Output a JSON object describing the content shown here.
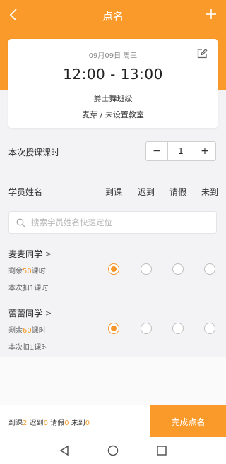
{
  "header": {
    "title": "点名",
    "back_icon": "chevron-left-icon",
    "add_icon": "plus-icon",
    "bg_color": "#f99a2a"
  },
  "card": {
    "date": "09月09日 周三",
    "time": "12:00 - 13:00",
    "class_name": "爵士舞班级",
    "room": "麦芽 / 未设置教室",
    "edit_icon": "edit-icon"
  },
  "lesson_hours": {
    "label": "本次授课课时",
    "minus": "−",
    "value": "1",
    "plus": "+"
  },
  "columns": {
    "student_name": "学员姓名",
    "present": "到课",
    "late": "迟到",
    "leave": "请假",
    "absent": "未到"
  },
  "search": {
    "placeholder": "搜索学员姓名快速定位",
    "icon": "search-icon"
  },
  "students": [
    {
      "name": "麦麦同学",
      "remain_prefix": "剩余",
      "remain_num": "50",
      "remain_suffix": "课时",
      "deduct": "本次扣1课时",
      "status": "present"
    },
    {
      "name": "蕾蕾同学",
      "remain_prefix": "剩余",
      "remain_num": "60",
      "remain_suffix": "课时",
      "deduct": "本次扣1课时",
      "status": "present"
    }
  ],
  "summary": {
    "present_label": "到课",
    "present_count": "2",
    "late_label": "迟到",
    "late_count": "0",
    "leave_label": "请假",
    "leave_count": "0",
    "absent_label": "未到",
    "absent_count": "0"
  },
  "complete_button": "完成点名",
  "navbar": {
    "back_icon": "nav-back-triangle-icon",
    "home_icon": "nav-home-circle-icon",
    "recents_icon": "nav-recents-square-icon"
  },
  "accent_color": "#f59b2a"
}
